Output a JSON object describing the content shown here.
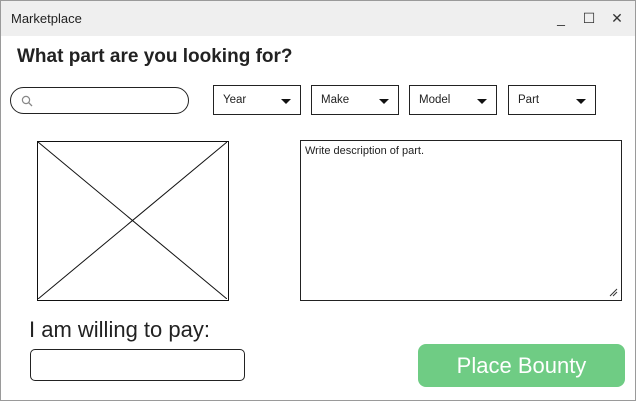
{
  "window": {
    "title": "Marketplace",
    "controls": {
      "minimize": "_",
      "maximize": "☐",
      "close": "✕"
    }
  },
  "heading": "What part are you looking for?",
  "search": {
    "placeholder": "",
    "value": "",
    "icon": "search-icon"
  },
  "filters": [
    {
      "label": "Year"
    },
    {
      "label": "Make"
    },
    {
      "label": "Model"
    },
    {
      "label": "Part"
    }
  ],
  "image_placeholder": {
    "icon": "image-placeholder-icon"
  },
  "description": {
    "value": "Write description of part."
  },
  "payment": {
    "label": "I am willing to pay:",
    "value": ""
  },
  "bounty_button": {
    "label": "Place Bounty",
    "color": "#6fcc84"
  }
}
